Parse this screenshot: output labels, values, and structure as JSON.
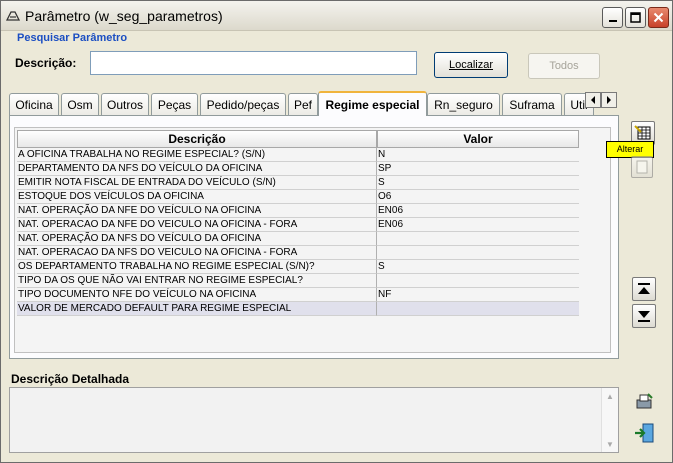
{
  "window": {
    "title": "Parâmetro (w_seg_parametros)",
    "controls": [
      "minimize",
      "maximize",
      "close"
    ]
  },
  "search": {
    "group_label": "Pesquisar Parâmetro",
    "description_label": "Descrição:",
    "description_value": "",
    "locate_button": "Localizar",
    "all_button": "Todos"
  },
  "tabs": [
    {
      "label": "Oficina"
    },
    {
      "label": "Osm"
    },
    {
      "label": "Outros"
    },
    {
      "label": "Peças"
    },
    {
      "label": "Pedido/peças"
    },
    {
      "label": "Pef"
    },
    {
      "label": "Regime especial",
      "active": true
    },
    {
      "label": "Rn_seguro"
    },
    {
      "label": "Suframa"
    },
    {
      "label": "Util"
    }
  ],
  "grid": {
    "columns": [
      "Descrição",
      "Valor"
    ],
    "rows": [
      {
        "desc": "A OFICINA TRABALHA NO REGIME ESPECIAL? (S/N)",
        "value": "N"
      },
      {
        "desc": "DEPARTAMENTO DA NFS DO VEÍCULO DA OFICINA",
        "value": "SP"
      },
      {
        "desc": "EMITIR NOTA FISCAL DE ENTRADA DO VEÍCULO (S/N)",
        "value": "S"
      },
      {
        "desc": "ESTOQUE DOS VEÍCULOS DA OFICINA",
        "value": "O6"
      },
      {
        "desc": "NAT. OPERAÇÃO DA NFE DO VEÍCULO NA OFICINA",
        "value": "EN06"
      },
      {
        "desc": "NAT. OPERACAO DA NFE DO VEICULO NA OFICINA - FORA",
        "value": "EN06"
      },
      {
        "desc": "NAT. OPERAÇÃO DA NFS DO VEÍCULO DA OFICINA",
        "value": ""
      },
      {
        "desc": "NAT. OPERACAO DA NFS DO VEICULO NA OFICINA - FORA",
        "value": ""
      },
      {
        "desc": "OS DEPARTAMENTO TRABALHA NO REGIME ESPECIAL (S/N)?",
        "value": "S"
      },
      {
        "desc": "TIPO DA OS QUE NÃO VAI ENTRAR NO REGIME ESPECIAL?",
        "value": ""
      },
      {
        "desc": "TIPO DOCUMENTO NFE DO VEÍCULO NA OFICINA",
        "value": "NF"
      },
      {
        "desc": "VALOR DE MERCADO DEFAULT PARA REGIME ESPECIAL",
        "value": "",
        "selected": true
      }
    ]
  },
  "side": {
    "edit_tooltip": "Alterar"
  },
  "detail": {
    "label": "Descrição Detalhada",
    "value": ""
  },
  "colors": {
    "group_label": "#1b4ec2",
    "tooltip_bg": "#ffff00",
    "active_tab_accent": "#f0b43c"
  }
}
